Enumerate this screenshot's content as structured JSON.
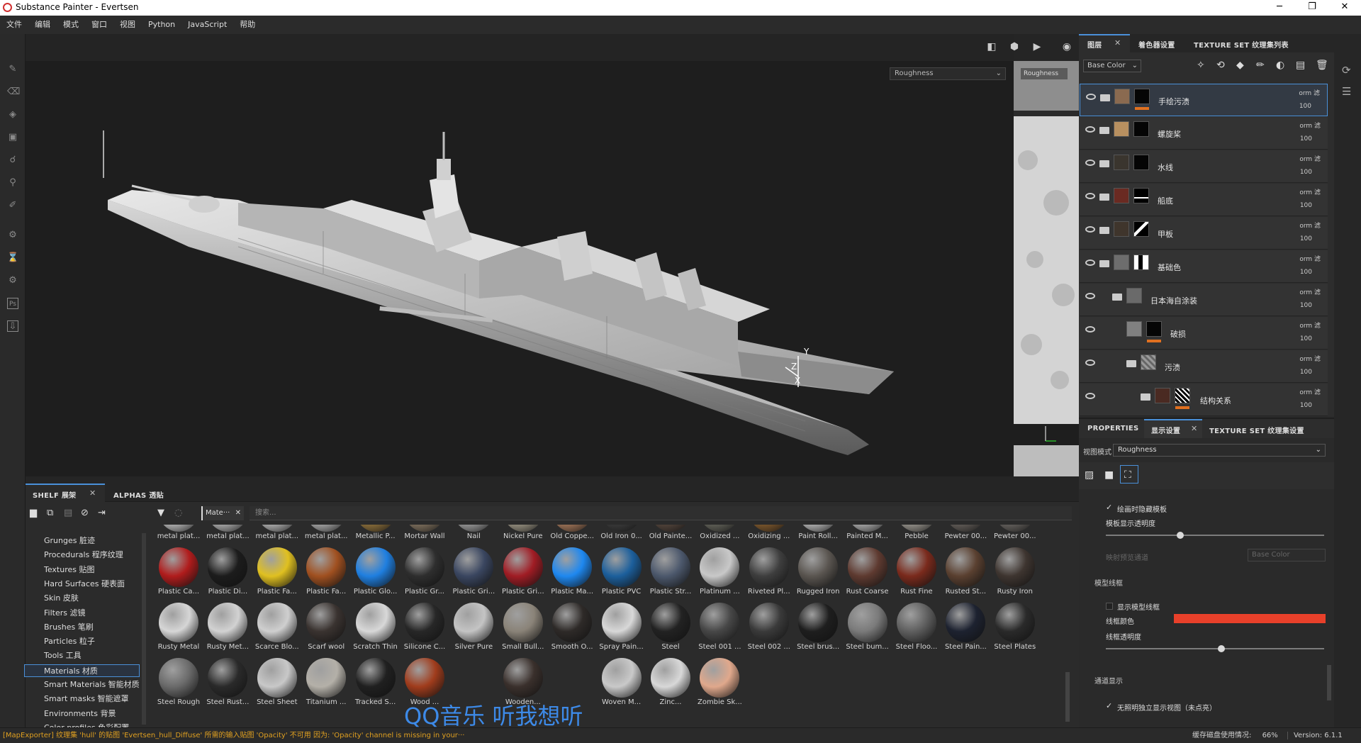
{
  "window": {
    "title": "Substance Painter - Evertsen"
  },
  "menu": [
    "文件",
    "编辑",
    "模式",
    "窗口",
    "视图",
    "Python",
    "JavaScript",
    "帮助"
  ],
  "viewport": {
    "channel_left": "Roughness",
    "channel_right": "Roughness",
    "axis_y": "Y",
    "axis_z": "Z",
    "axis_x": "X"
  },
  "layers_panel": {
    "tabs": [
      "图层",
      "着色器设置",
      "TEXTURE SET 纹理集列表"
    ],
    "channel": "Base Color",
    "layers": [
      {
        "name": "手绘污渍",
        "blend": "orm 滤",
        "opacity": "100"
      },
      {
        "name": "螺旋桨",
        "blend": "orm 滤",
        "opacity": "100"
      },
      {
        "name": "水线",
        "blend": "orm 滤",
        "opacity": "100"
      },
      {
        "name": "船底",
        "blend": "orm 滤",
        "opacity": "100"
      },
      {
        "name": "甲板",
        "blend": "orm 滤",
        "opacity": "100"
      },
      {
        "name": "基础色",
        "blend": "orm 滤",
        "opacity": "100"
      },
      {
        "name": "日本海自涂装",
        "blend": "orm 滤",
        "opacity": "100"
      },
      {
        "name": "破损",
        "blend": "orm 滤",
        "opacity": "100"
      },
      {
        "name": "污渍",
        "blend": "orm 滤",
        "opacity": "100"
      },
      {
        "name": "结构关系",
        "blend": "orm 滤",
        "opacity": "100"
      }
    ]
  },
  "properties": {
    "tabs": [
      "PROPERTIES",
      "显示设置",
      "TEXTURE SET 纹理集设置"
    ],
    "view_mode_label": "视图模式",
    "view_mode_value": "Roughness",
    "hide_template": "绘画时隐藏模板",
    "template_opacity": "模板显示透明度",
    "proj_channel": "映射预览通道",
    "proj_channel_value": "Base Color",
    "wireframe_section": "模型线框",
    "show_wireframe": "显示模型线框",
    "wire_color": "线框颜色",
    "wire_opacity": "线框透明度",
    "channel_section": "通道显示",
    "no_light": "无照明独立显示视图（未点亮）",
    "wire_color_hex": "#e8402a"
  },
  "shelf": {
    "tabs": [
      "SHELF 展架",
      "ALPHAS 透贴"
    ],
    "filter_chip": "Mate···",
    "search_placeholder": "搜索...",
    "categories": [
      "Grunges 脏迹",
      "Procedurals 程序纹理",
      "Textures 贴图",
      "Hard Surfaces 硬表面",
      "Skin 皮肤",
      "Filters 滤镜",
      "Brushes 笔刷",
      "Particles 粒子",
      "Tools 工具",
      "Materials 材质",
      "Smart Materials 智能材质",
      "Smart masks 智能遮罩",
      "Environments 背景",
      "Color profiles 色彩配置"
    ],
    "selected_category": "Materials 材质",
    "rows": [
      [
        "metal plat...",
        "metal plat...",
        "metal plat...",
        "metal plat...",
        "Metallic P...",
        "Mortar Wall",
        "Nail",
        "Nickel Pure",
        "Old Coppe...",
        "Old Iron 0...",
        "Old Painte...",
        "Oxidized ...",
        "Oxidizing ...",
        "Paint Roll...",
        "Painted M...",
        "Pebble",
        "Pewter 00...",
        "Pewter 00..."
      ],
      [
        "Plastic Ca...",
        "Plastic Di...",
        "Plastic Fa...",
        "Plastic Fa...",
        "Plastic Glo...",
        "Plastic Gr...",
        "Plastic Gri...",
        "Plastic Gri...",
        "Plastic Ma...",
        "Plastic PVC",
        "Plastic Str...",
        "Platinum ...",
        "Riveted Pl...",
        "Rugged Iron",
        "Rust Coarse",
        "Rust Fine",
        "Rusted St...",
        "Rusty Iron"
      ],
      [
        "Rusty Metal",
        "Rusty Met...",
        "Scarce Blo...",
        "Scarf wool",
        "Scratch Thin",
        "Silicone C...",
        "Silver Pure",
        "Small Bull...",
        "Smooth O...",
        "Spray Pain...",
        "Steel",
        "Steel 001 ...",
        "Steel 002 ...",
        "Steel brus...",
        "Steel bum...",
        "Steel Floo...",
        "Steel Pain...",
        "Steel Plates"
      ],
      [
        "Steel Rough",
        "Steel Rust...",
        "Steel Sheet",
        "Titanium ...",
        "Tracked S...",
        "Wood ...",
        "",
        "Wooden...",
        "",
        "Woven M...",
        "Zinc...",
        "Zombie Sk..."
      ]
    ]
  },
  "status": {
    "log": "[MapExporter] 纹理集 'hull' 的贴图 'Evertsen_hull_Diffuse' 所需的输入贴图 'Opacity' 不可用 因为: 'Opacity' channel is missing in your···",
    "cache": "缓存磁盘使用情况:",
    "cache_value": "66%",
    "version": "Version: 6.1.1"
  },
  "watermark": "QQ音乐 听我想听"
}
